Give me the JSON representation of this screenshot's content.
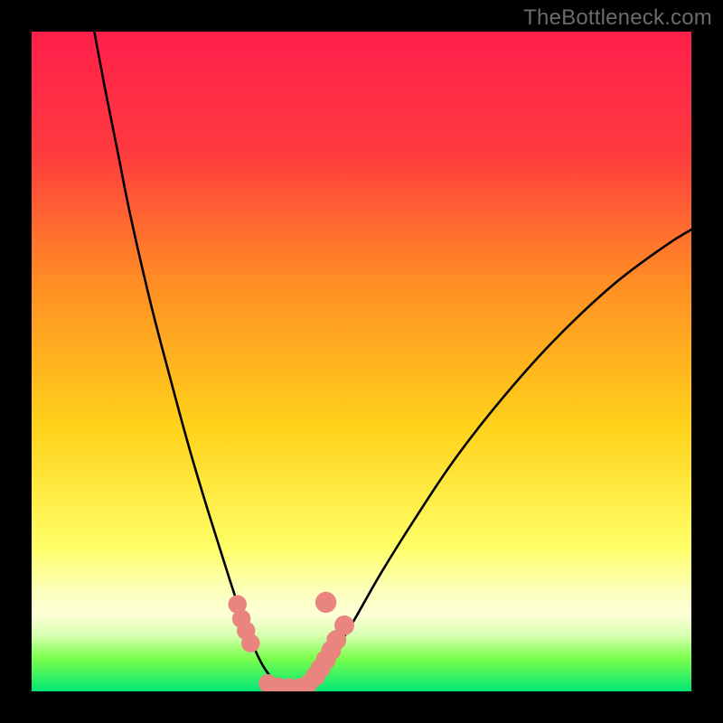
{
  "watermark": "TheBottleneck.com",
  "chart_data": {
    "type": "line",
    "title": "",
    "xlabel": "",
    "ylabel": "",
    "xlim": [
      0,
      100
    ],
    "ylim": [
      0,
      100
    ],
    "grid": false,
    "legend": null,
    "gradient_colors": {
      "top": "#ff1f4b",
      "upper_mid": "#ff6a2a",
      "mid": "#ffd21a",
      "lower_mid": "#ffff8a",
      "band": "#fcffce",
      "low": "#7bff4c",
      "bottom": "#00e676"
    },
    "series": [
      {
        "name": "left-curve",
        "x": [
          9.5,
          11,
          13,
          15,
          18,
          21,
          24,
          27,
          30,
          31.5,
          33,
          34,
          35,
          36,
          37,
          37.6
        ],
        "y": [
          100,
          92,
          82,
          72,
          59,
          47.5,
          36.5,
          26.5,
          17,
          12.5,
          8.5,
          6,
          4,
          2.5,
          1.3,
          0.5
        ]
      },
      {
        "name": "right-curve",
        "x": [
          41.5,
          42.5,
          44,
          46,
          49,
          53,
          58,
          64,
          71,
          79,
          88,
          96,
          100
        ],
        "y": [
          0.5,
          1.3,
          3,
          6,
          11,
          18,
          26,
          35,
          44,
          53,
          61.5,
          67.5,
          70
        ]
      },
      {
        "name": "floor-line",
        "x": [
          37.6,
          41.5
        ],
        "y": [
          0.5,
          0.5
        ]
      }
    ],
    "markers": [
      {
        "name": "left-cluster",
        "points": [
          {
            "x": 31.2,
            "y": 13.2
          },
          {
            "x": 31.8,
            "y": 11.0
          },
          {
            "x": 32.5,
            "y": 9.2
          },
          {
            "x": 33.2,
            "y": 7.3
          }
        ],
        "radius": 1.4
      },
      {
        "name": "floor-cluster",
        "points": [
          {
            "x": 35.8,
            "y": 1.2
          },
          {
            "x": 37.4,
            "y": 0.7
          },
          {
            "x": 39.0,
            "y": 0.6
          },
          {
            "x": 40.6,
            "y": 0.6
          },
          {
            "x": 42.0,
            "y": 1.2
          }
        ],
        "radius": 1.4
      },
      {
        "name": "right-cluster",
        "points": [
          {
            "x": 43.0,
            "y": 2.3
          },
          {
            "x": 43.8,
            "y": 3.5
          },
          {
            "x": 44.6,
            "y": 4.8
          },
          {
            "x": 45.4,
            "y": 6.2
          },
          {
            "x": 46.2,
            "y": 7.8
          },
          {
            "x": 47.4,
            "y": 10.0
          }
        ],
        "radius": 1.5
      },
      {
        "name": "right-outlier",
        "points": [
          {
            "x": 44.6,
            "y": 13.5
          }
        ],
        "radius": 1.6
      }
    ],
    "marker_color": "#e9847e"
  }
}
